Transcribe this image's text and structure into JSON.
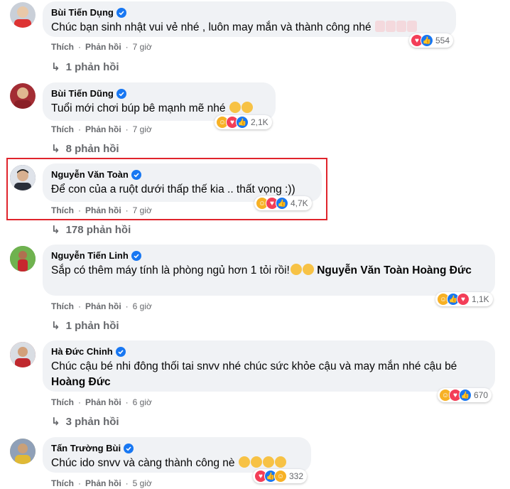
{
  "comments": [
    {
      "name": "Bùi Tiến Dụng",
      "text": "Chúc bạn sinh nhật vui vẻ nhé , luôn may mắn và thành công nhé",
      "like": "Thích",
      "reply": "Phản hồi",
      "time": "7 giờ",
      "reactions": [
        "love",
        "like"
      ],
      "count": "554",
      "replies": "1 phản hồi",
      "avatar_color": "#c9cfd8",
      "emoji": [
        "cake",
        "cake",
        "cake",
        "cake"
      ]
    },
    {
      "name": "Bùi Tiến Dũng",
      "text": "Tuổi mới chơi búp bê mạnh mẽ nhé",
      "like": "Thích",
      "reply": "Phản hồi",
      "time": "7 giờ",
      "reactions": [
        "haha",
        "love",
        "like"
      ],
      "count": "2,1K",
      "replies": "8 phản hồi",
      "avatar_color": "#a32d34",
      "emoji": [
        "face",
        "face"
      ]
    },
    {
      "name": "Nguyễn Văn Toàn",
      "text": "Để con của a ruột dưới thấp thế kia .. thất vọng :))",
      "like": "Thích",
      "reply": "Phản hồi",
      "time": "7 giờ",
      "reactions": [
        "haha",
        "love",
        "like"
      ],
      "count": "4,7K",
      "replies": "178 phản hồi",
      "avatar_color": "#4a5060",
      "emoji": []
    },
    {
      "name": "Nguyễn Tiến Linh",
      "text": "Sắp có thêm máy tính là phòng ngủ hơn 1 tỏi rồi!",
      "mention": "Nguyễn Văn Toàn Hoàng Đức",
      "like": "Thích",
      "reply": "Phản hồi",
      "time": "6 giờ",
      "reactions": [
        "haha",
        "like",
        "love"
      ],
      "count": "1,1K",
      "replies": "1 phản hồi",
      "avatar_color": "#3f8f3a",
      "emoji": [
        "face",
        "face"
      ]
    },
    {
      "name": "Hà Đức Chinh",
      "text": "Chúc cậu bé nhi đông thối tai snvv nhé chúc sức khỏe cậu và may mắn nhé cậu bé",
      "mention": "Hoàng Đức",
      "like": "Thích",
      "reply": "Phản hồi",
      "time": "6 giờ",
      "reactions": [
        "haha",
        "love",
        "like"
      ],
      "count": "670",
      "replies": "3 phản hồi",
      "avatar_color": "#b94b3f",
      "emoji": []
    },
    {
      "name": "Tấn Trường Bùi",
      "text": "Chúc ido snvv và càng thành công nè",
      "like": "Thích",
      "reply": "Phản hồi",
      "time": "5 giờ",
      "reactions": [
        "love",
        "like",
        "haha"
      ],
      "count": "332",
      "avatar_color": "#d8b24a",
      "emoji": [
        "face",
        "face",
        "face",
        "face"
      ]
    }
  ]
}
